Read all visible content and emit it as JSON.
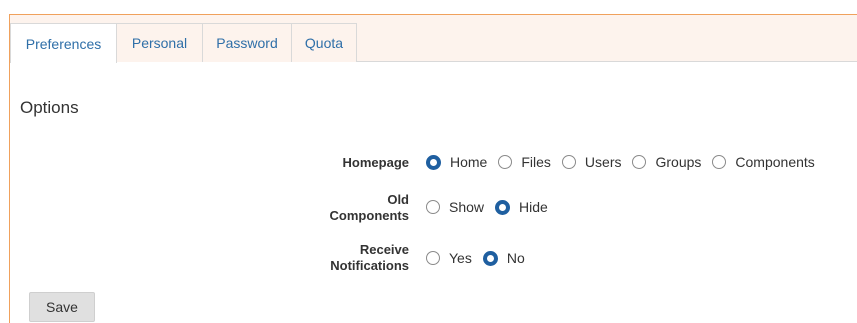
{
  "tabs": [
    {
      "label": "Preferences",
      "active": true
    },
    {
      "label": "Personal",
      "active": false
    },
    {
      "label": "Password",
      "active": false
    },
    {
      "label": "Quota",
      "active": false
    }
  ],
  "section_title": "Options",
  "fields": {
    "homepage": {
      "label": "Homepage",
      "options": [
        "Home",
        "Files",
        "Users",
        "Groups",
        "Components"
      ],
      "selected": "Home"
    },
    "old_components": {
      "label_line1": "Old",
      "label_line2": "Components",
      "options": [
        "Show",
        "Hide"
      ],
      "selected": "Hide"
    },
    "receive_notifications": {
      "label_line1": "Receive",
      "label_line2": "Notifications",
      "options": [
        "Yes",
        "No"
      ],
      "selected": "No"
    }
  },
  "save_label": "Save",
  "colors": {
    "accent_border": "#f0a15c",
    "tab_bg": "#fdf3ed",
    "radio_checked": "#1f5fa0",
    "link": "#2f6fa8"
  }
}
